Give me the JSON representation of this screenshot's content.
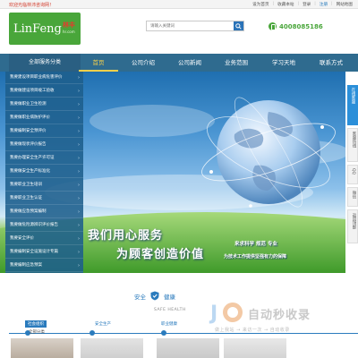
{
  "topbar": {
    "welcome": "欢迎光临林沛咨询网！",
    "links": [
      "设为首页",
      "收藏本站",
      "登录",
      "注册",
      "网站地图"
    ]
  },
  "logo": {
    "latin": "LinFeng",
    "cn": "林丰",
    "domain": "hr.com"
  },
  "search": {
    "placeholder": "请输入关键词"
  },
  "phone": {
    "number": "4008085186"
  },
  "nav": {
    "category_title": "全部服务分类",
    "items": [
      "首页",
      "公司介绍",
      "公司新闻",
      "业务范围",
      "学习天地",
      "联系方式"
    ],
    "active_index": 0
  },
  "sidemenu": {
    "items": [
      "我要建设项目职业病危害评价",
      "我要做建设项目竣工验收",
      "我要做职业卫生检测",
      "我要做职业病防护评价",
      "我要编制安全预评价",
      "我要做现状评价报告",
      "我要办理安全生产许可证",
      "我要做安全生产标准化",
      "我要职业卫生培训",
      "我要职业卫生认证",
      "我要做应急预案编制",
      "我要做危险源辨识评价报告",
      "我要安全评价",
      "我要编制安全设施设计专篇",
      "我要编制应急预案"
    ],
    "chevron": "›"
  },
  "hero": {
    "slogan_line1": "我们用心服务",
    "slogan_line2": "为顾客创造价值",
    "motto_line1": "来求科学  规范  专业",
    "motto_line2": "为技术工作提供坚强有力的保障"
  },
  "rightbar": {
    "blue_label": "在线客服",
    "items": [
      "客服热线",
      "QQ",
      "微信",
      "返回顶部"
    ]
  },
  "section": {
    "safety": "安全",
    "health": "健康",
    "english": "SAFE HEALTH",
    "tabs": [
      "社会组织",
      "安全生产",
      "职业健康"
    ],
    "more": "全部分类"
  },
  "watermark": {
    "title": "自动秒收录",
    "sub": "做上我站 → 来访一次 → 自动收录"
  },
  "colors": {
    "brand_green": "#49a63a",
    "nav_blue": "#2f6b8f",
    "accent_blue": "#2a7bbd",
    "welcome_red": "#d23a2a",
    "active_yellow": "#f7d04a"
  }
}
